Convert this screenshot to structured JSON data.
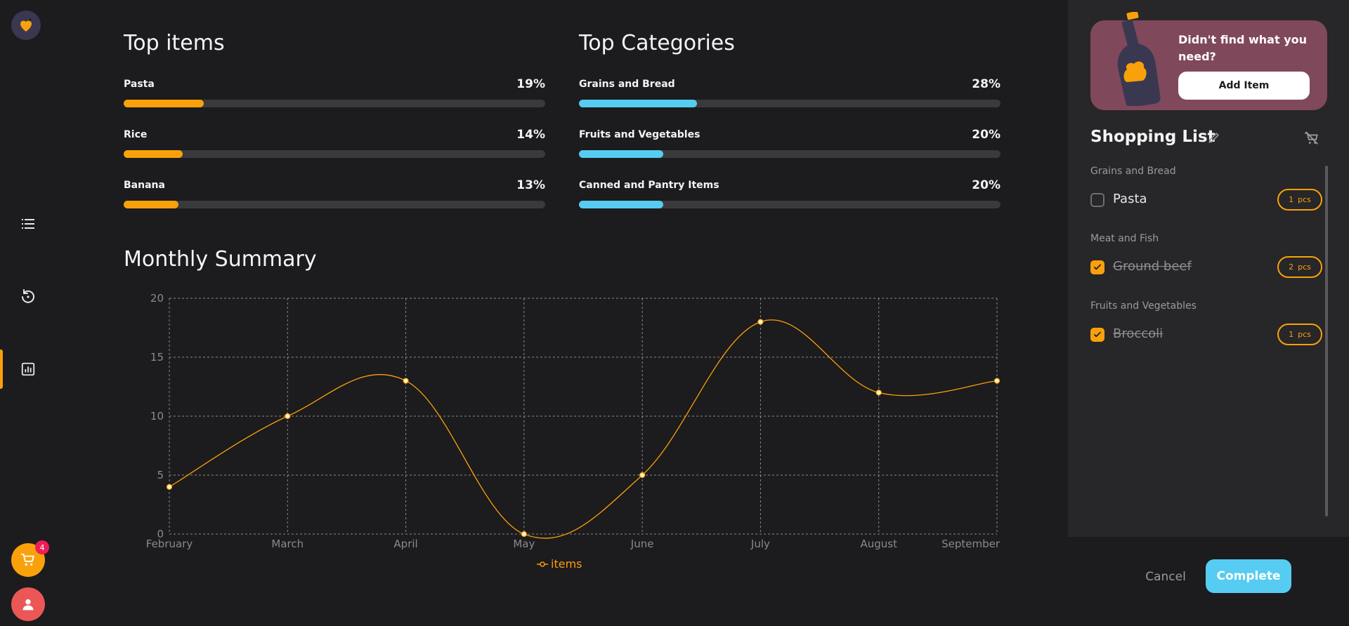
{
  "sidebar": {
    "nav": [
      {
        "icon": "list-icon"
      },
      {
        "icon": "history-icon"
      },
      {
        "icon": "chart-icon"
      }
    ],
    "cart_count": "4"
  },
  "top_items": {
    "title": "Top items",
    "color": "#f9a10a",
    "items": [
      {
        "label": "Pasta",
        "pct": "19%",
        "value": 19
      },
      {
        "label": "Rice",
        "pct": "14%",
        "value": 14
      },
      {
        "label": "Banana",
        "pct": "13%",
        "value": 13
      }
    ]
  },
  "top_categories": {
    "title": "Top Categories",
    "color": "#56ccf2",
    "items": [
      {
        "label": "Grains and Bread",
        "pct": "28%",
        "value": 28
      },
      {
        "label": "Fruits and Vegetables",
        "pct": "20%",
        "value": 20
      },
      {
        "label": "Canned and Pantry Items",
        "pct": "20%",
        "value": 20
      }
    ]
  },
  "summary": {
    "title": "Monthly Summary",
    "legend": "items"
  },
  "chart_data": {
    "type": "line",
    "x": [
      "February",
      "March",
      "April",
      "May",
      "June",
      "July",
      "August",
      "September"
    ],
    "series": [
      {
        "name": "items",
        "values": [
          4,
          10,
          13,
          0,
          5,
          18,
          12,
          13
        ],
        "color": "#f9a10a"
      }
    ],
    "yticks": [
      0,
      5,
      10,
      15,
      20
    ],
    "ylim": [
      0,
      20
    ],
    "grid": true,
    "legend_position": "bottom"
  },
  "promo": {
    "text": "Didn't find what you need?",
    "button": "Add Item"
  },
  "shopping_list": {
    "title": "Shopping List",
    "unit": "pcs",
    "groups": [
      {
        "category": "Grains and Bread",
        "items": [
          {
            "name": "Pasta",
            "qty": "1",
            "checked": false
          }
        ]
      },
      {
        "category": "Meat and Fish",
        "items": [
          {
            "name": "Ground beef",
            "qty": "2",
            "checked": true
          }
        ]
      },
      {
        "category": "Fruits and Vegetables",
        "items": [
          {
            "name": "Broccoli",
            "qty": "1",
            "checked": true
          }
        ]
      }
    ]
  },
  "footer": {
    "cancel": "Cancel",
    "complete": "Complete"
  }
}
